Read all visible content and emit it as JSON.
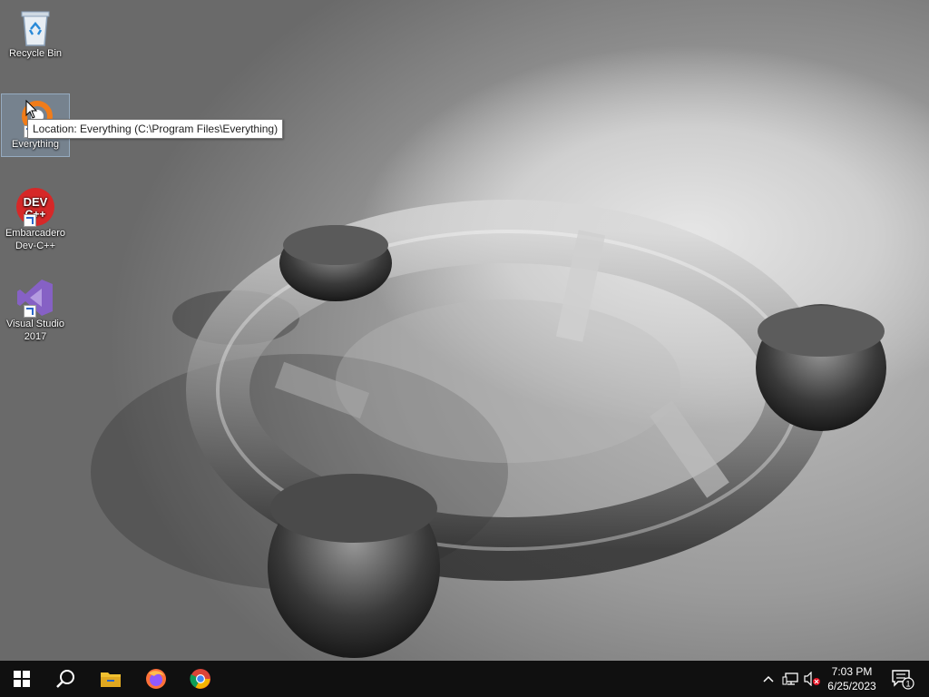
{
  "desktop": {
    "icons": [
      {
        "label": "Recycle Bin",
        "icon": "recycle-bin-icon"
      },
      {
        "label": "Everything",
        "icon": "everything-app-icon"
      },
      {
        "label": "Embarcadero Dev-C++",
        "icon": "devcpp-icon",
        "icon_text_top": "DEV",
        "icon_text_bottom": "C++"
      },
      {
        "label": "Visual Studio 2017",
        "icon": "visual-studio-icon"
      }
    ],
    "tooltip": "Location: Everything (C:\\Program Files\\Everything)"
  },
  "taskbar": {
    "start": "windows-start-icon",
    "search": "search-icon",
    "pinned": [
      "file-explorer-icon",
      "firefox-icon",
      "chrome-icon"
    ],
    "tray": [
      "chevron-up-icon",
      "network-icon",
      "volume-muted-icon"
    ],
    "clock": {
      "time": "7:03 PM",
      "date": "6/25/2023"
    },
    "notifications": {
      "icon": "action-center-icon",
      "count": "1"
    }
  },
  "colors": {
    "taskbar_bg": "#101010",
    "devcpp_red": "#d62828",
    "vs_purple": "#8661c5",
    "explorer_yellow": "#f0c030"
  }
}
